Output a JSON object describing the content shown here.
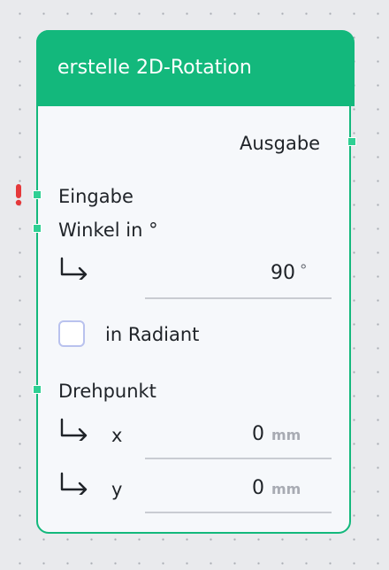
{
  "node": {
    "title": "erstelle 2D-Rotation",
    "output_label": "Ausgabe",
    "input_label": "Eingabe",
    "angle_label": "Winkel in °",
    "angle_value": "90",
    "angle_unit": "°",
    "radian_label": "in Radiant",
    "radian_checked": false,
    "pivot_label": "Drehpunkt",
    "pivot_x_label": "x",
    "pivot_x_value": "0",
    "pivot_y_label": "y",
    "pivot_y_value": "0",
    "length_unit": "mm",
    "warning_icon": "exclamation-icon",
    "colors": {
      "accent": "#13b87c",
      "port": "#2fcf93",
      "warning": "#e5393b",
      "background": "#e9eaed"
    }
  }
}
